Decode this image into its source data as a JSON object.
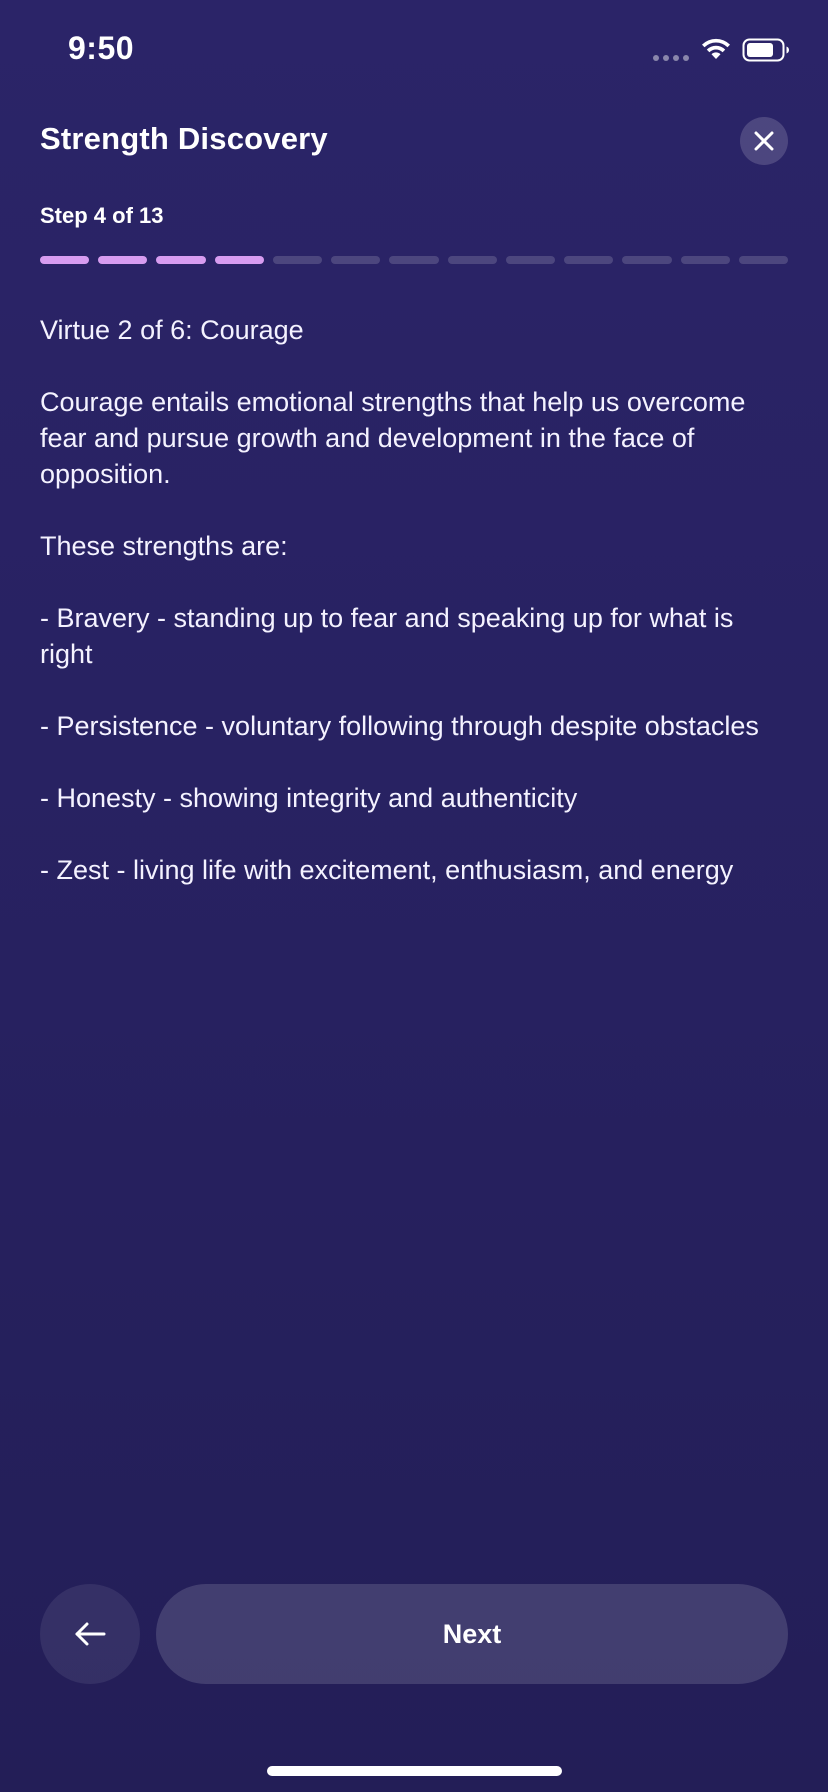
{
  "status_bar": {
    "time": "9:50"
  },
  "header": {
    "title": "Strength Discovery",
    "close_icon": "close-icon"
  },
  "progress": {
    "label": "Step 4 of 13",
    "current_step": 4,
    "total_steps": 13,
    "active_color": "#d79cf0"
  },
  "content": {
    "virtue_heading": "Virtue 2 of 6: Courage",
    "description": "Courage entails emotional strengths that help us overcome fear and pursue growth and development in the face of opposition.",
    "intro": "These strengths are:",
    "strengths": [
      "- Bravery - standing up to fear and speaking up for what is right",
      "- Persistence - voluntary following through despite obstacles",
      "- Honesty - showing integrity and authenticity",
      "- Zest - living life with excitement, enthusiasm, and energy"
    ]
  },
  "footer": {
    "back_icon": "arrow-left-icon",
    "next_label": "Next"
  },
  "colors": {
    "background": "#2b2468",
    "accent": "#d79cf0"
  }
}
